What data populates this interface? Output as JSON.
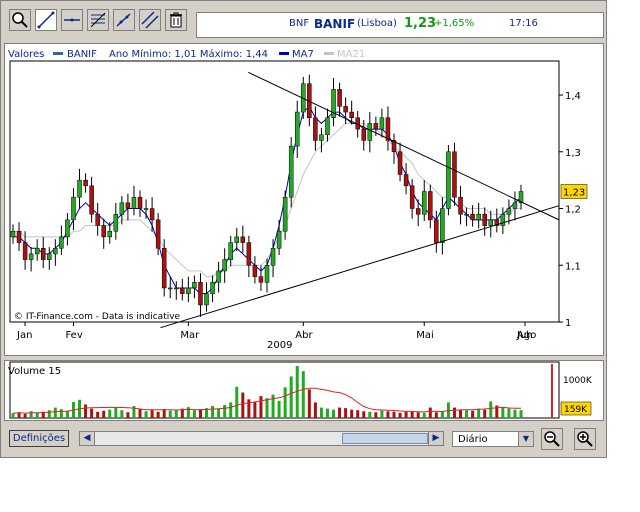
{
  "quote": {
    "symbol": "BNF",
    "name": "BANIF",
    "exchange": "(Lisboa)",
    "price": "1,23",
    "change": "+1,65%",
    "time": "17:16"
  },
  "legend": {
    "label": "Valores",
    "series1": "BANIF",
    "range": "Ano Mínimo: 1,01 Máximo: 1,44",
    "series2": "MA7",
    "series3": "MA21"
  },
  "watermark": "© IT-Finance.com - Data is indicative",
  "colors": {
    "up": "#22aa22",
    "down": "#aa1111",
    "ma7": "#0000bb",
    "ma21": "#c4c4c4",
    "accent": "#0b2a8c",
    "price_label": "#ffd700",
    "volume_line": "#dd2222"
  },
  "controls": {
    "definicoes": "Definições",
    "period": "Diário"
  },
  "toolbar_icons": [
    "magnify-icon",
    "draw-line-icon",
    "horizontal-line-icon",
    "fibonacci-icon",
    "trend-icon",
    "parallel-line-icon",
    "trash-icon"
  ],
  "chart_data": [
    {
      "type": "candlestick",
      "title": "",
      "series": [
        {
          "name": "BANIF",
          "values": [
            1.16,
            1.14,
            1.11,
            1.12,
            1.13,
            1.11,
            1.12,
            1.13,
            1.15,
            1.18,
            1.22,
            1.25,
            1.24,
            1.19,
            1.17,
            1.15,
            1.16,
            1.19,
            1.21,
            1.2,
            1.22,
            1.2,
            1.2,
            1.18,
            1.13,
            1.06,
            1.06,
            1.06,
            1.05,
            1.06,
            1.07,
            1.03,
            1.05,
            1.07,
            1.09,
            1.11,
            1.14,
            1.15,
            1.14,
            1.1,
            1.08,
            1.07,
            1.1,
            1.13,
            1.16,
            1.22,
            1.31,
            1.37,
            1.42,
            1.36,
            1.32,
            1.33,
            1.36,
            1.41,
            1.38,
            1.37,
            1.36,
            1.34,
            1.32,
            1.35,
            1.34,
            1.36,
            1.32,
            1.3,
            1.26,
            1.24,
            1.2,
            1.19,
            1.23,
            1.18,
            1.14,
            1.2,
            1.3,
            1.22,
            1.19,
            1.19,
            1.18,
            1.19,
            1.17,
            1.18,
            1.17,
            1.19,
            1.2,
            1.21,
            1.23
          ]
        },
        {
          "name": "MA7",
          "values": [
            1.15,
            1.15,
            1.14,
            1.13,
            1.13,
            1.12,
            1.12,
            1.13,
            1.14,
            1.16,
            1.18,
            1.2,
            1.21,
            1.2,
            1.19,
            1.18,
            1.17,
            1.18,
            1.19,
            1.2,
            1.2,
            1.2,
            1.19,
            1.17,
            1.14,
            1.1,
            1.08,
            1.06,
            1.06,
            1.06,
            1.06,
            1.05,
            1.05,
            1.06,
            1.08,
            1.1,
            1.12,
            1.13,
            1.12,
            1.11,
            1.1,
            1.09,
            1.1,
            1.13,
            1.17,
            1.22,
            1.28,
            1.33,
            1.37,
            1.38,
            1.36,
            1.35,
            1.36,
            1.37,
            1.37,
            1.36,
            1.35,
            1.35,
            1.34,
            1.34,
            1.34,
            1.34,
            1.33,
            1.31,
            1.28,
            1.26,
            1.23,
            1.21,
            1.2,
            1.19,
            1.18,
            1.2,
            1.22,
            1.21,
            1.2,
            1.19,
            1.18,
            1.18,
            1.18,
            1.18,
            1.18,
            1.19,
            1.2,
            1.21,
            1.22
          ]
        },
        {
          "name": "MA21",
          "values": [
            1.16,
            1.16,
            1.15,
            1.15,
            1.15,
            1.15,
            1.15,
            1.15,
            1.15,
            1.15,
            1.16,
            1.16,
            1.17,
            1.17,
            1.17,
            1.17,
            1.17,
            1.17,
            1.18,
            1.18,
            1.18,
            1.18,
            1.17,
            1.16,
            1.15,
            1.13,
            1.12,
            1.11,
            1.1,
            1.09,
            1.09,
            1.09,
            1.08,
            1.08,
            1.09,
            1.09,
            1.1,
            1.1,
            1.1,
            1.1,
            1.1,
            1.1,
            1.11,
            1.13,
            1.15,
            1.17,
            1.2,
            1.23,
            1.26,
            1.28,
            1.3,
            1.31,
            1.32,
            1.33,
            1.34,
            1.35,
            1.35,
            1.35,
            1.35,
            1.34,
            1.34,
            1.33,
            1.32,
            1.31,
            1.3,
            1.29,
            1.28,
            1.26,
            1.25,
            1.24,
            1.23,
            1.22,
            1.22,
            1.21,
            1.21,
            1.2,
            1.2,
            1.2,
            1.2,
            1.19,
            1.19,
            1.19,
            1.19,
            1.2,
            1.2
          ]
        }
      ],
      "y_ticks": [
        "1,4",
        "1,3",
        "1,2",
        "1,1",
        "1"
      ],
      "ylim": [
        1.0,
        1.46
      ],
      "x_ticks": [
        "Jan",
        "Fev",
        "Mar",
        "Abr",
        "Mai",
        "Jun",
        "Jul",
        "Ago"
      ],
      "xlabel": "2009",
      "last_price_label": "1,23",
      "trendlines": "symmetrical triangle: upper line from the May high to August, lower line from the March low to August",
      "grid": false
    },
    {
      "type": "bar",
      "title": "Volume 15",
      "series": [
        {
          "name": "Volume 15",
          "values": [
            90,
            110,
            80,
            130,
            100,
            120,
            150,
            200,
            170,
            140,
            310,
            350,
            260,
            180,
            120,
            140,
            160,
            200,
            150,
            110,
            230,
            180,
            130,
            150,
            120,
            170,
            140,
            160,
            180,
            210,
            150,
            170,
            190,
            230,
            180,
            250,
            300,
            600,
            490,
            360,
            310,
            420,
            380,
            450,
            330,
            590,
            800,
            1000,
            900,
            550,
            300,
            200,
            180,
            160,
            200,
            190,
            160,
            150,
            130,
            120,
            110,
            140,
            130,
            120,
            100,
            120,
            130,
            110,
            100,
            200,
            110,
            130,
            300,
            200,
            160,
            150,
            140,
            180,
            160,
            320,
            240,
            200,
            180,
            160,
            150
          ]
        }
      ],
      "y_ticks": [
        "1000K",
        "159K"
      ],
      "grid": false
    }
  ]
}
